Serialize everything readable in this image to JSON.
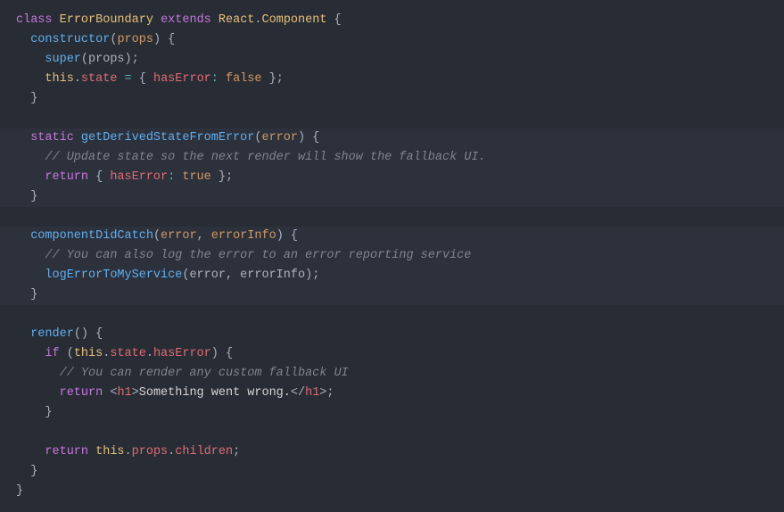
{
  "code": {
    "l1": {
      "kw_class": "class",
      "name": "ErrorBoundary",
      "kw_extends": "extends",
      "react": "React",
      "component": "Component"
    },
    "l2": {
      "constructor": "constructor",
      "props": "props"
    },
    "l3": {
      "super": "super",
      "props": "props"
    },
    "l4": {
      "this": "this",
      "state": "state",
      "hasError": "hasError",
      "false": "false"
    },
    "l7": {
      "static": "static",
      "method": "getDerivedStateFromError",
      "error": "error"
    },
    "l8": {
      "comment": "// Update state so the next render will show the fallback UI."
    },
    "l9": {
      "return": "return",
      "hasError": "hasError",
      "true": "true"
    },
    "l12": {
      "method": "componentDidCatch",
      "error": "error",
      "errorInfo": "errorInfo"
    },
    "l13": {
      "comment": "// You can also log the error to an error reporting service"
    },
    "l14": {
      "fn": "logErrorToMyService",
      "error": "error",
      "errorInfo": "errorInfo"
    },
    "l17": {
      "method": "render"
    },
    "l18": {
      "if": "if",
      "this": "this",
      "state": "state",
      "hasError": "hasError"
    },
    "l19": {
      "comment": "// You can render any custom fallback UI"
    },
    "l20": {
      "return": "return",
      "tag": "h1",
      "text": "Something went wrong.",
      "closeTag": "h1"
    },
    "l23": {
      "return": "return",
      "this": "this",
      "props": "props",
      "children": "children"
    }
  }
}
